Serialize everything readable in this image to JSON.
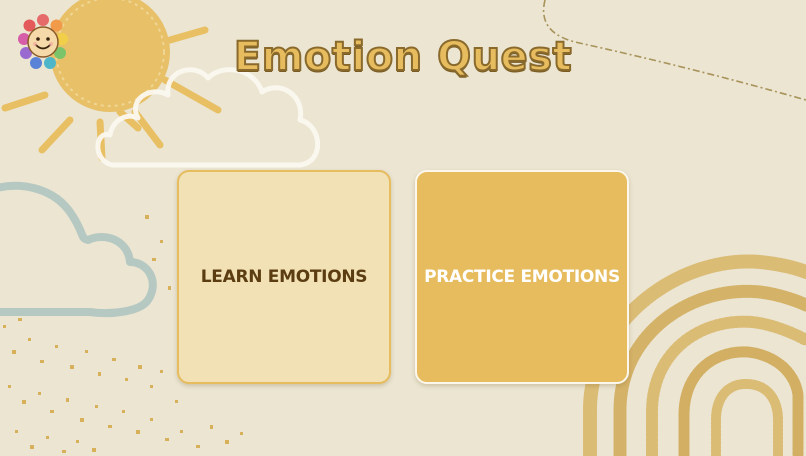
{
  "app": {
    "title": "Emotion Quest"
  },
  "logo": {
    "icon": "smiley-flower-logo-icon"
  },
  "menu": {
    "learn_label": "LEARN EMOTIONS",
    "practice_label": "PRACTICE EMOTIONS"
  },
  "colors": {
    "background": "#ebe5d2",
    "accent_gold": "#e6bc5e",
    "card_light": "#f1e1b5",
    "text_brown": "#5c3d12",
    "text_white": "#ffffff",
    "cloud_teal": "#b6c8c2"
  }
}
